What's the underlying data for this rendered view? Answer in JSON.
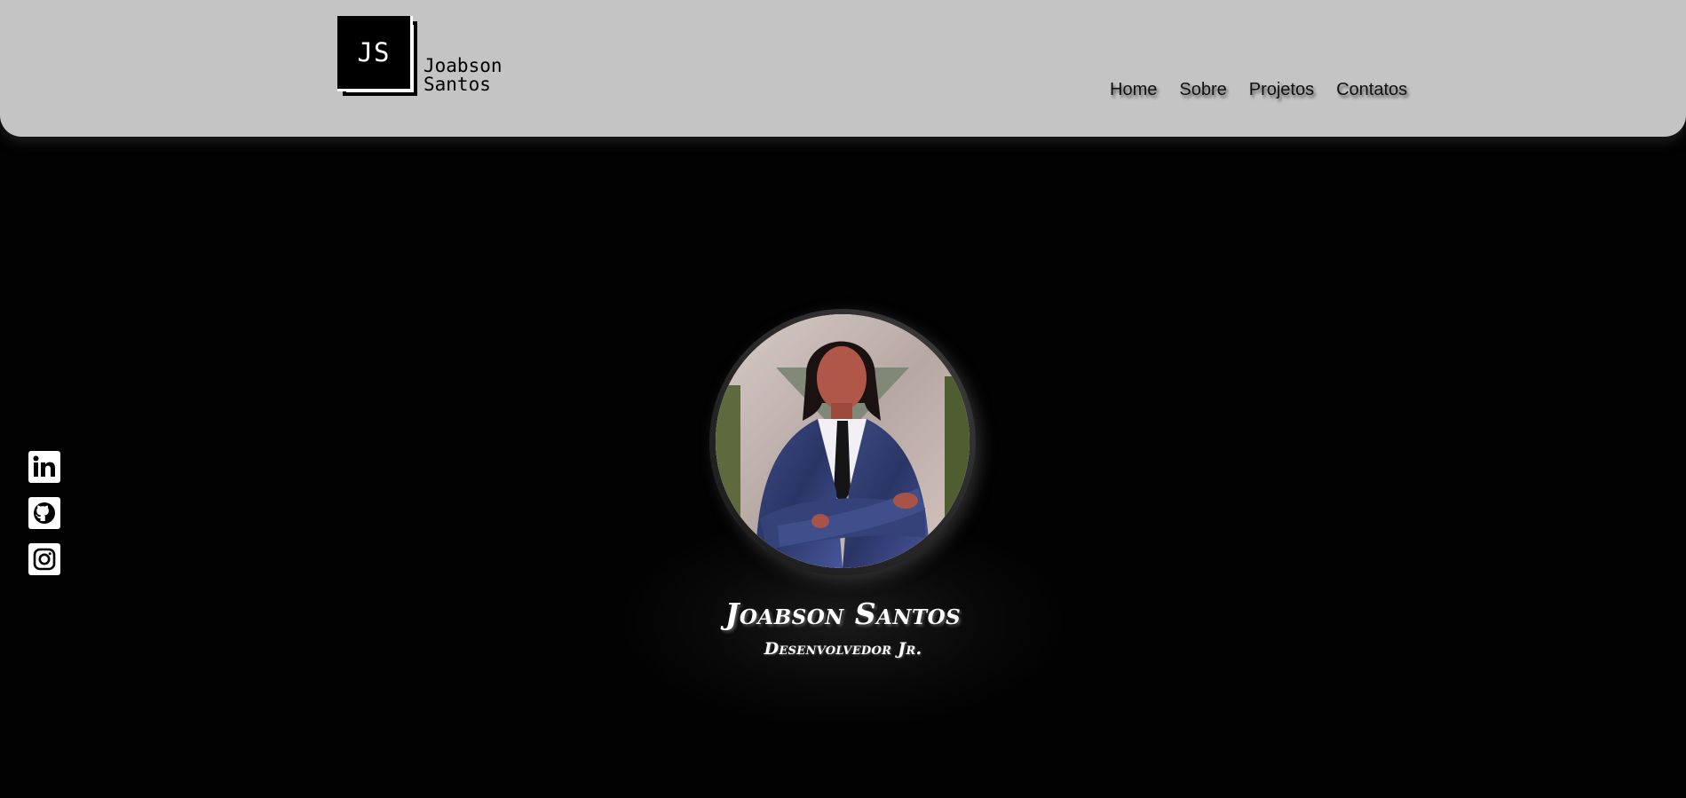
{
  "header": {
    "logo": {
      "initials": "JS",
      "name": "Joabson\nSantos"
    },
    "nav": [
      {
        "label": "Home"
      },
      {
        "label": "Sobre"
      },
      {
        "label": "Projetos"
      },
      {
        "label": "Contatos"
      }
    ]
  },
  "social": [
    {
      "icon": "linkedin-icon"
    },
    {
      "icon": "github-icon"
    },
    {
      "icon": "instagram-icon"
    }
  ],
  "profile": {
    "name": "Joabson Santos",
    "role": "Desenvolvedor Jr."
  },
  "colors": {
    "header_bg": "#c4c4c4",
    "page_bg": "#020202",
    "text_light": "#ffffff",
    "text_dark": "#111111"
  }
}
